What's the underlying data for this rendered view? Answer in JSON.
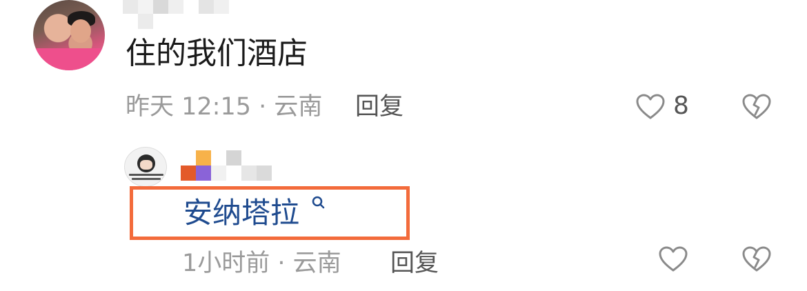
{
  "comments": [
    {
      "text": "住的我们酒店",
      "meta": "昨天 12:15 · 云南",
      "reply_label": "回复",
      "like_count": "8"
    },
    {
      "keyword_link": "安纳塔拉",
      "meta": "1小时前 · 云南",
      "reply_label": "回复"
    }
  ],
  "colors": {
    "highlight_box": "#f36b3b",
    "link": "#1f4b8f",
    "meta": "#9a9a9a"
  },
  "icons": [
    "heart-icon",
    "broken-heart-icon",
    "search-icon"
  ]
}
